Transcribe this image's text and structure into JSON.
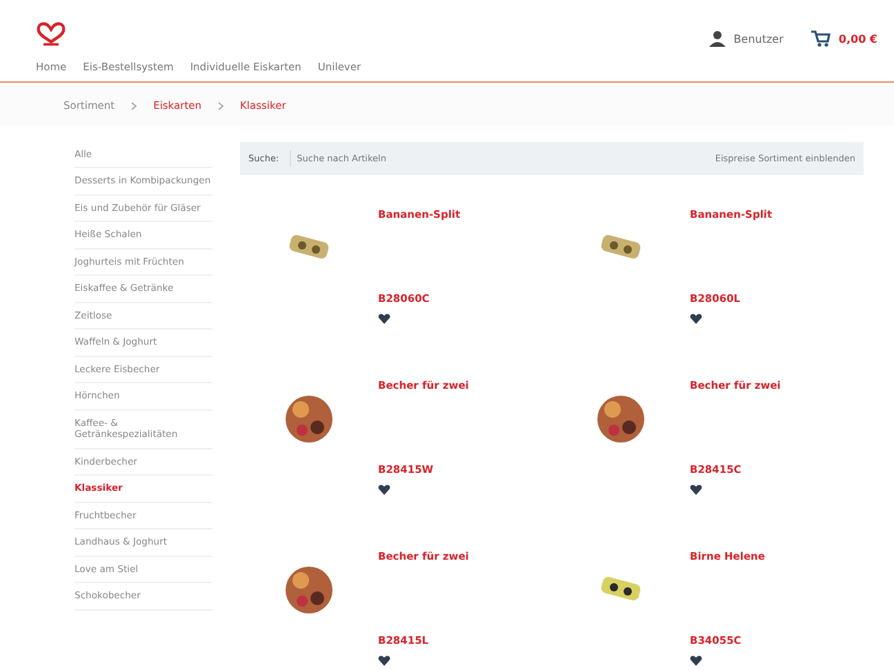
{
  "header": {
    "user_name": "Benutzer",
    "cart_total": "0,00 €"
  },
  "nav": [
    "Home",
    "Eis-Bestellsystem",
    "Individuelle Eiskarten",
    "Unilever"
  ],
  "breadcrumb": [
    {
      "label": "Sortiment",
      "color": "#888888"
    },
    {
      "label": "Eiskarten",
      "color": "#d8232a"
    },
    {
      "label": "Klassiker",
      "color": "#d8232a"
    }
  ],
  "sidebar": {
    "items": [
      {
        "label": "Alle",
        "selected": false
      },
      {
        "label": "Desserts in Kombipackungen",
        "selected": false
      },
      {
        "label": "Eis und Zubehör für Gläser",
        "selected": false
      },
      {
        "label": "Heiße Schalen",
        "selected": false
      },
      {
        "label": "Joghurteis mit Früchten",
        "selected": false
      },
      {
        "label": "Eiskaffee & Getränke",
        "selected": false
      },
      {
        "label": "Zeitlose",
        "selected": false
      },
      {
        "label": "Waffeln & Joghurt",
        "selected": false
      },
      {
        "label": "Leckere Eisbecher",
        "selected": false
      },
      {
        "label": "Hörnchen",
        "selected": false
      },
      {
        "label": "Kaffee- & Getränkespezialitäten",
        "selected": false
      },
      {
        "label": "Kinderbecher",
        "selected": false
      },
      {
        "label": "Klassiker",
        "selected": true
      },
      {
        "label": "Fruchtbecher",
        "selected": false
      },
      {
        "label": "Landhaus & Joghurt",
        "selected": false
      },
      {
        "label": "Love am Stiel",
        "selected": false
      },
      {
        "label": "Schokobecher",
        "selected": false
      }
    ]
  },
  "search": {
    "label": "Suche:",
    "placeholder": "Suche nach Artikeln",
    "toggle": "Eispreise Sortiment einblenden"
  },
  "products": [
    {
      "name": "Bananen-Split",
      "code": "B28060C",
      "kind": "banana-split"
    },
    {
      "name": "Bananen-Split",
      "code": "B28060L",
      "kind": "banana-split"
    },
    {
      "name": "Becher für zwei",
      "code": "B28415W",
      "kind": "sundae"
    },
    {
      "name": "Becher für zwei",
      "code": "B28415C",
      "kind": "sundae"
    },
    {
      "name": "Becher für zwei",
      "code": "B28415L",
      "kind": "sundae"
    },
    {
      "name": "Birne Helene",
      "code": "B34055C",
      "kind": "pear"
    }
  ]
}
